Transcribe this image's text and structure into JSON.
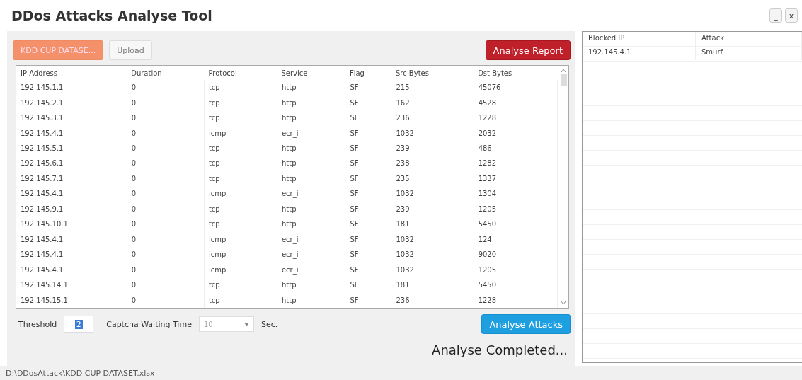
{
  "window": {
    "title": "DDos Attacks Analyse Tool",
    "controls": [
      "_",
      "x"
    ]
  },
  "toolbar": {
    "dataset_button": "KDD CUP DATASE...",
    "upload_button": "Upload",
    "report_button": "Analyse Report"
  },
  "table": {
    "columns": [
      "IP Address",
      "Duration",
      "Protocol",
      "Service",
      "Flag",
      "Src Bytes",
      "Dst Bytes"
    ],
    "rows": [
      [
        "192.145.1.1",
        "0",
        "tcp",
        "http",
        "SF",
        "215",
        "45076"
      ],
      [
        "192.145.2.1",
        "0",
        "tcp",
        "http",
        "SF",
        "162",
        "4528"
      ],
      [
        "192.145.3.1",
        "0",
        "tcp",
        "http",
        "SF",
        "236",
        "1228"
      ],
      [
        "192.145.4.1",
        "0",
        "icmp",
        "ecr_i",
        "SF",
        "1032",
        "2032"
      ],
      [
        "192.145.5.1",
        "0",
        "tcp",
        "http",
        "SF",
        "239",
        "486"
      ],
      [
        "192.145.6.1",
        "0",
        "tcp",
        "http",
        "SF",
        "238",
        "1282"
      ],
      [
        "192.145.7.1",
        "0",
        "tcp",
        "http",
        "SF",
        "235",
        "1337"
      ],
      [
        "192.145.4.1",
        "0",
        "icmp",
        "ecr_i",
        "SF",
        "1032",
        "1304"
      ],
      [
        "192.145.9.1",
        "0",
        "tcp",
        "http",
        "SF",
        "239",
        "1205"
      ],
      [
        "192.145.10.1",
        "0",
        "tcp",
        "http",
        "SF",
        "181",
        "5450"
      ],
      [
        "192.145.4.1",
        "0",
        "icmp",
        "ecr_i",
        "SF",
        "1032",
        "124"
      ],
      [
        "192.145.4.1",
        "0",
        "icmp",
        "ecr_i",
        "SF",
        "1032",
        "9020"
      ],
      [
        "192.145.4.1",
        "0",
        "icmp",
        "ecr_i",
        "SF",
        "1032",
        "1205"
      ],
      [
        "192.145.14.1",
        "0",
        "tcp",
        "http",
        "SF",
        "181",
        "5450"
      ],
      [
        "192.145.15.1",
        "0",
        "tcp",
        "http",
        "SF",
        "236",
        "1228"
      ]
    ]
  },
  "settings": {
    "threshold_label": "Threshold",
    "threshold_value": "2",
    "captcha_label": "Captcha Waiting Time",
    "captcha_value": "10",
    "unit": "Sec.",
    "analyse_button": "Analyse Attacks"
  },
  "status_message": "Analyse Completed...",
  "blocked_table": {
    "columns": [
      "Blocked IP",
      "Attack"
    ],
    "rows": [
      [
        "192.145.4.1",
        "Smurf"
      ]
    ]
  },
  "status_bar": "D:\\DDosAttack\\KDD CUP DATASET.xlsx"
}
